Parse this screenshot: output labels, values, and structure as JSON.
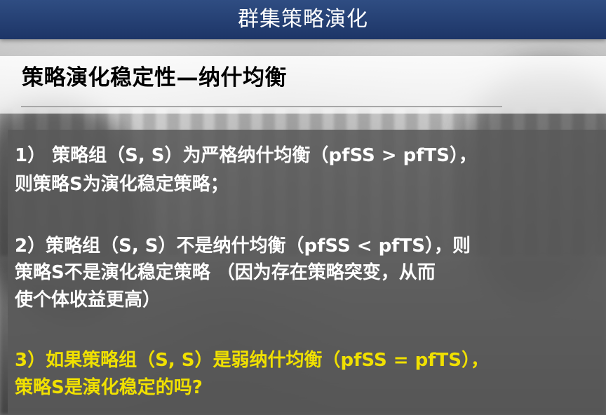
{
  "slide": {
    "title": "群集策略演化",
    "subtitle": "策略演化稳定性—纳什均衡",
    "paragraphs": [
      {
        "lines": [
          "1） 策略组（S, S）为严格纳什均衡（pfSS > pfTS），",
          "则策略S为演化稳定策略；"
        ]
      },
      {
        "lines": [
          "2）策略组（S, S）不是纳什均衡（pfSS < pfTS），则",
          "策略S不是演化稳定策略 （因为存在策略突变，从而",
          "使个体收益更高）"
        ]
      },
      {
        "lines": [
          "3）如果策略组（S, S）是弱纳什均衡（pfSS = pfTS），",
          "策略S是演化稳定的吗?"
        ]
      }
    ]
  },
  "colors": {
    "title_bar": "#1d3567",
    "title_text": "#ffffff",
    "subtitle_text": "#000000",
    "body_text": "#ffffff",
    "highlight_text": "#f0e000",
    "content_panel": "#5a5a5a"
  }
}
